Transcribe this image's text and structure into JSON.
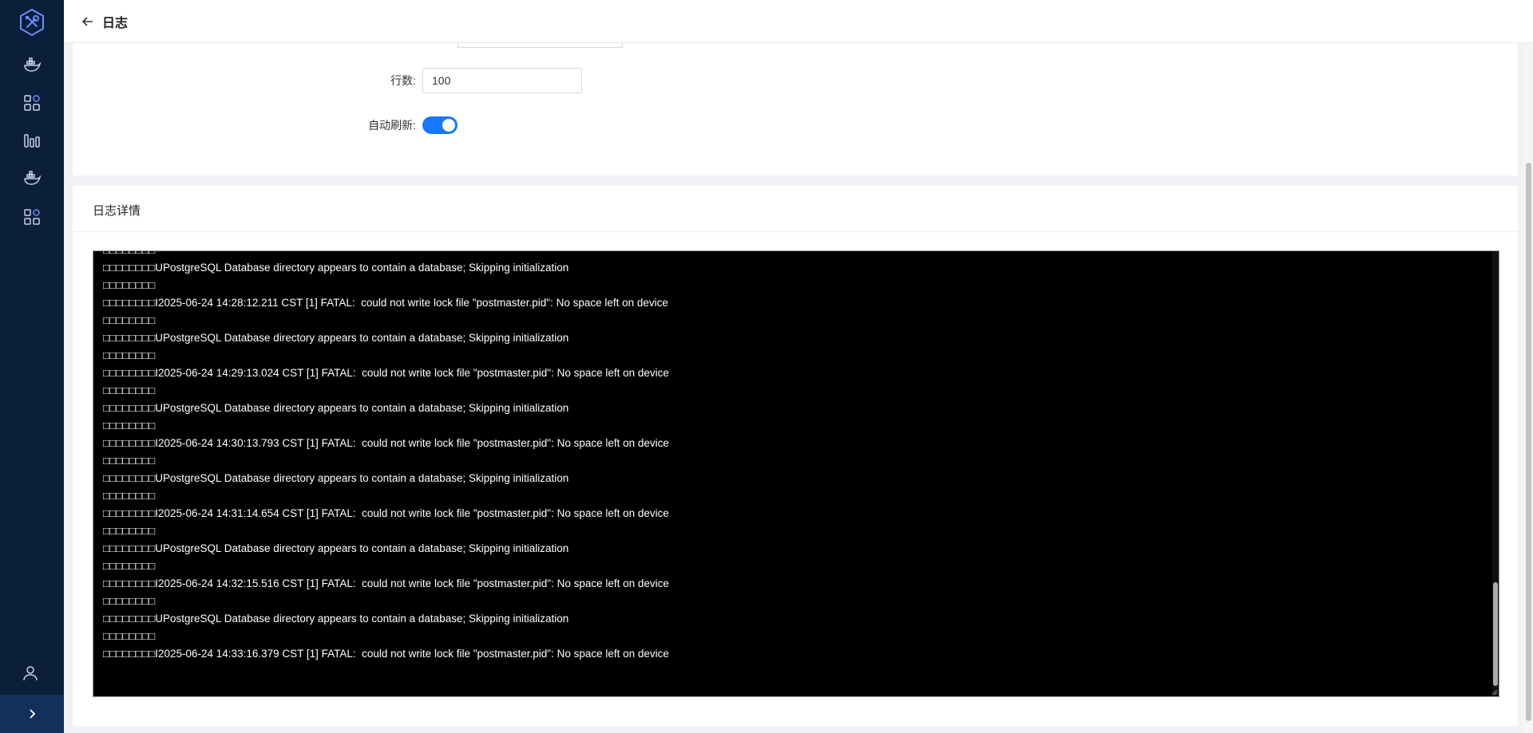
{
  "header": {
    "title": "日志"
  },
  "sidebar": {
    "logo_icon": "wrench-screwdriver-hex-logo",
    "items": [
      {
        "icon": "docker-icon"
      },
      {
        "icon": "apps-grid-icon"
      },
      {
        "icon": "bar-chart-icon"
      },
      {
        "icon": "docker-icon"
      },
      {
        "icon": "apps-grid-icon"
      }
    ],
    "user_icon": "user-icon",
    "collapse_icon": "chevron-right-icon"
  },
  "form": {
    "lines_label": "行数:",
    "lines_value": "100",
    "auto_refresh_label": "自动刷新:",
    "auto_refresh_on": true
  },
  "detail": {
    "title": "日志详情",
    "lines": [
      "□□□□□□□□",
      "□□□□□□□□UPostgreSQL Database directory appears to contain a database; Skipping initialization",
      "□□□□□□□□",
      "□□□□□□□□I2025-06-24 14:28:12.211 CST [1] FATAL:  could not write lock file \"postmaster.pid\": No space left on device",
      "□□□□□□□□",
      "□□□□□□□□UPostgreSQL Database directory appears to contain a database; Skipping initialization",
      "□□□□□□□□",
      "□□□□□□□□I2025-06-24 14:29:13.024 CST [1] FATAL:  could not write lock file \"postmaster.pid\": No space left on device",
      "□□□□□□□□",
      "□□□□□□□□UPostgreSQL Database directory appears to contain a database; Skipping initialization",
      "□□□□□□□□",
      "□□□□□□□□I2025-06-24 14:30:13.793 CST [1] FATAL:  could not write lock file \"postmaster.pid\": No space left on device",
      "□□□□□□□□",
      "□□□□□□□□UPostgreSQL Database directory appears to contain a database; Skipping initialization",
      "□□□□□□□□",
      "□□□□□□□□I2025-06-24 14:31:14.654 CST [1] FATAL:  could not write lock file \"postmaster.pid\": No space left on device",
      "□□□□□□□□",
      "□□□□□□□□UPostgreSQL Database directory appears to contain a database; Skipping initialization",
      "□□□□□□□□",
      "□□□□□□□□I2025-06-24 14:32:15.516 CST [1] FATAL:  could not write lock file \"postmaster.pid\": No space left on device",
      "□□□□□□□□",
      "□□□□□□□□UPostgreSQL Database directory appears to contain a database; Skipping initialization",
      "□□□□□□□□",
      "□□□□□□□□I2025-06-24 14:33:16.379 CST [1] FATAL:  could not write lock file \"postmaster.pid\": No space left on device"
    ]
  },
  "colors": {
    "sidebar_bg": "#0b1e3a",
    "accent": "#1677ff",
    "log_bg": "#000000",
    "log_text": "#ffffff"
  }
}
